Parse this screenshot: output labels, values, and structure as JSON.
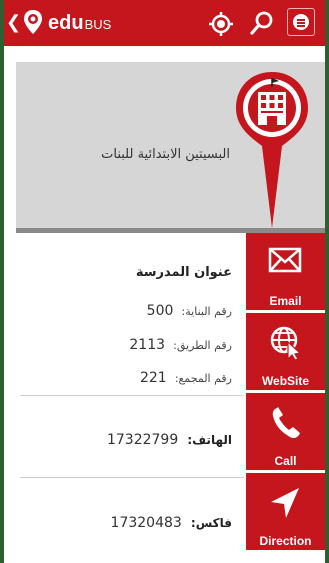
{
  "app": {
    "brand_main": "edu",
    "brand_sub": "BUS",
    "back_glyph": "❮",
    "icons": [
      "back-icon",
      "logo-pin-icon",
      "location-target-icon",
      "search-icon",
      "menu-icon"
    ]
  },
  "school": {
    "name": "البسيتين الابتدائية للبنات"
  },
  "address": {
    "title": "عنوان المدرسة",
    "building_label": "رقم البناية:",
    "building_value": "500",
    "road_label": "رقم الطريق:",
    "road_value": "2113",
    "block_label": "رقم المجمع:",
    "block_value": "221"
  },
  "contact": {
    "phone_label": "الهاتف:",
    "phone_value": "17322799",
    "fax_label": "فاكس:",
    "fax_value": "17320483"
  },
  "actions": {
    "email": "Email",
    "website": "WebSite",
    "call": "Call",
    "direction": "Direction"
  },
  "colors": {
    "brand_red": "#c4161c",
    "card_grey": "#d6d6d6",
    "frame_green": "#2f5f2f"
  }
}
